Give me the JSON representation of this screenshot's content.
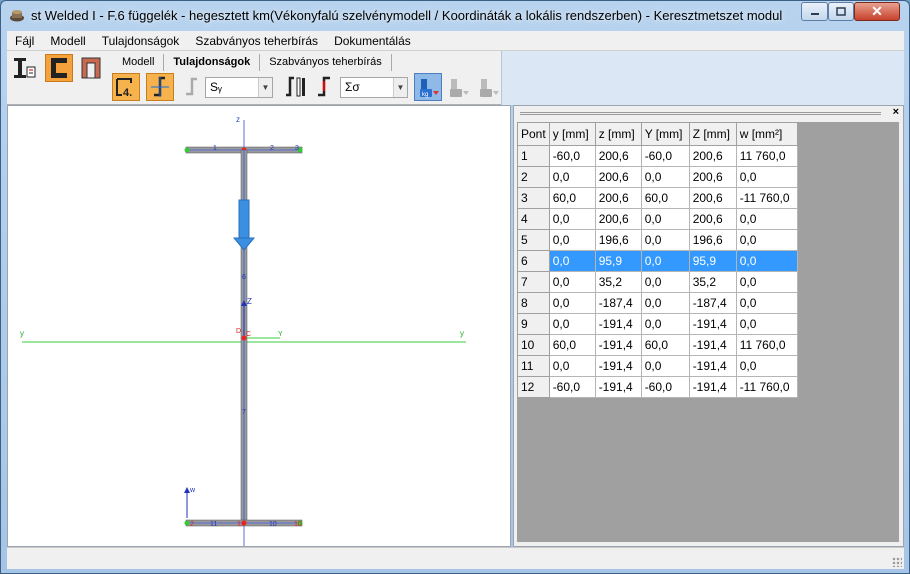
{
  "window": {
    "title": "st Welded I - F.6 függelék - hegesztett km(Vékonyfalú szelvénymodell / Koordináták a lokális rendszerben) - Keresztmetszet modul"
  },
  "menu": [
    "Fájl",
    "Modell",
    "Tulajdonságok",
    "Szabványos teherbírás",
    "Dokumentálás"
  ],
  "toolbar": {
    "tabs": [
      "Modell",
      "Tulajdonságok",
      "Szabványos teherbírás"
    ],
    "active_tab": 1,
    "combo_stress_comp": "Sᵧ",
    "combo_stress_sum": "Σσ",
    "tool4_label": "4."
  },
  "drawing": {
    "axis_z_top": "z",
    "axis_y_left": "y",
    "axis_y_right": "y",
    "Z_label": "Z",
    "Y_label": "Y",
    "D_label": "D",
    "C_label": "C",
    "w_label": "w",
    "node_top_1": "1",
    "node_top_2": "2",
    "node_top_3": "3",
    "node_bot_2": "2",
    "node_bot_11": "11",
    "node_bot_10": "10",
    "node_bot_1x": "1x",
    "node_bot_19": "10",
    "web_num_6": "6",
    "web_num_7": "7",
    "colors": {
      "accent": "#3b8fe0",
      "axis_green": "#2ecc40",
      "web_blue": "#4e6fd6",
      "node_red": "#e02020"
    }
  },
  "table": {
    "headers": [
      "Pont",
      "y [mm]",
      "z [mm]",
      "Y [mm]",
      "Z [mm]",
      "w [mm²]"
    ],
    "selected_row": 5,
    "rows": [
      [
        "1",
        "-60,0",
        "200,6",
        "-60,0",
        "200,6",
        "11 760,0"
      ],
      [
        "2",
        "0,0",
        "200,6",
        "0,0",
        "200,6",
        "0,0"
      ],
      [
        "3",
        "60,0",
        "200,6",
        "60,0",
        "200,6",
        "-11 760,0"
      ],
      [
        "4",
        "0,0",
        "200,6",
        "0,0",
        "200,6",
        "0,0"
      ],
      [
        "5",
        "0,0",
        "196,6",
        "0,0",
        "196,6",
        "0,0"
      ],
      [
        "6",
        "0,0",
        "95,9",
        "0,0",
        "95,9",
        "0,0"
      ],
      [
        "7",
        "0,0",
        "35,2",
        "0,0",
        "35,2",
        "0,0"
      ],
      [
        "8",
        "0,0",
        "-187,4",
        "0,0",
        "-187,4",
        "0,0"
      ],
      [
        "9",
        "0,0",
        "-191,4",
        "0,0",
        "-191,4",
        "0,0"
      ],
      [
        "10",
        "60,0",
        "-191,4",
        "60,0",
        "-191,4",
        "11 760,0"
      ],
      [
        "11",
        "0,0",
        "-191,4",
        "0,0",
        "-191,4",
        "0,0"
      ],
      [
        "12",
        "-60,0",
        "-191,4",
        "-60,0",
        "-191,4",
        "-11 760,0"
      ]
    ]
  }
}
